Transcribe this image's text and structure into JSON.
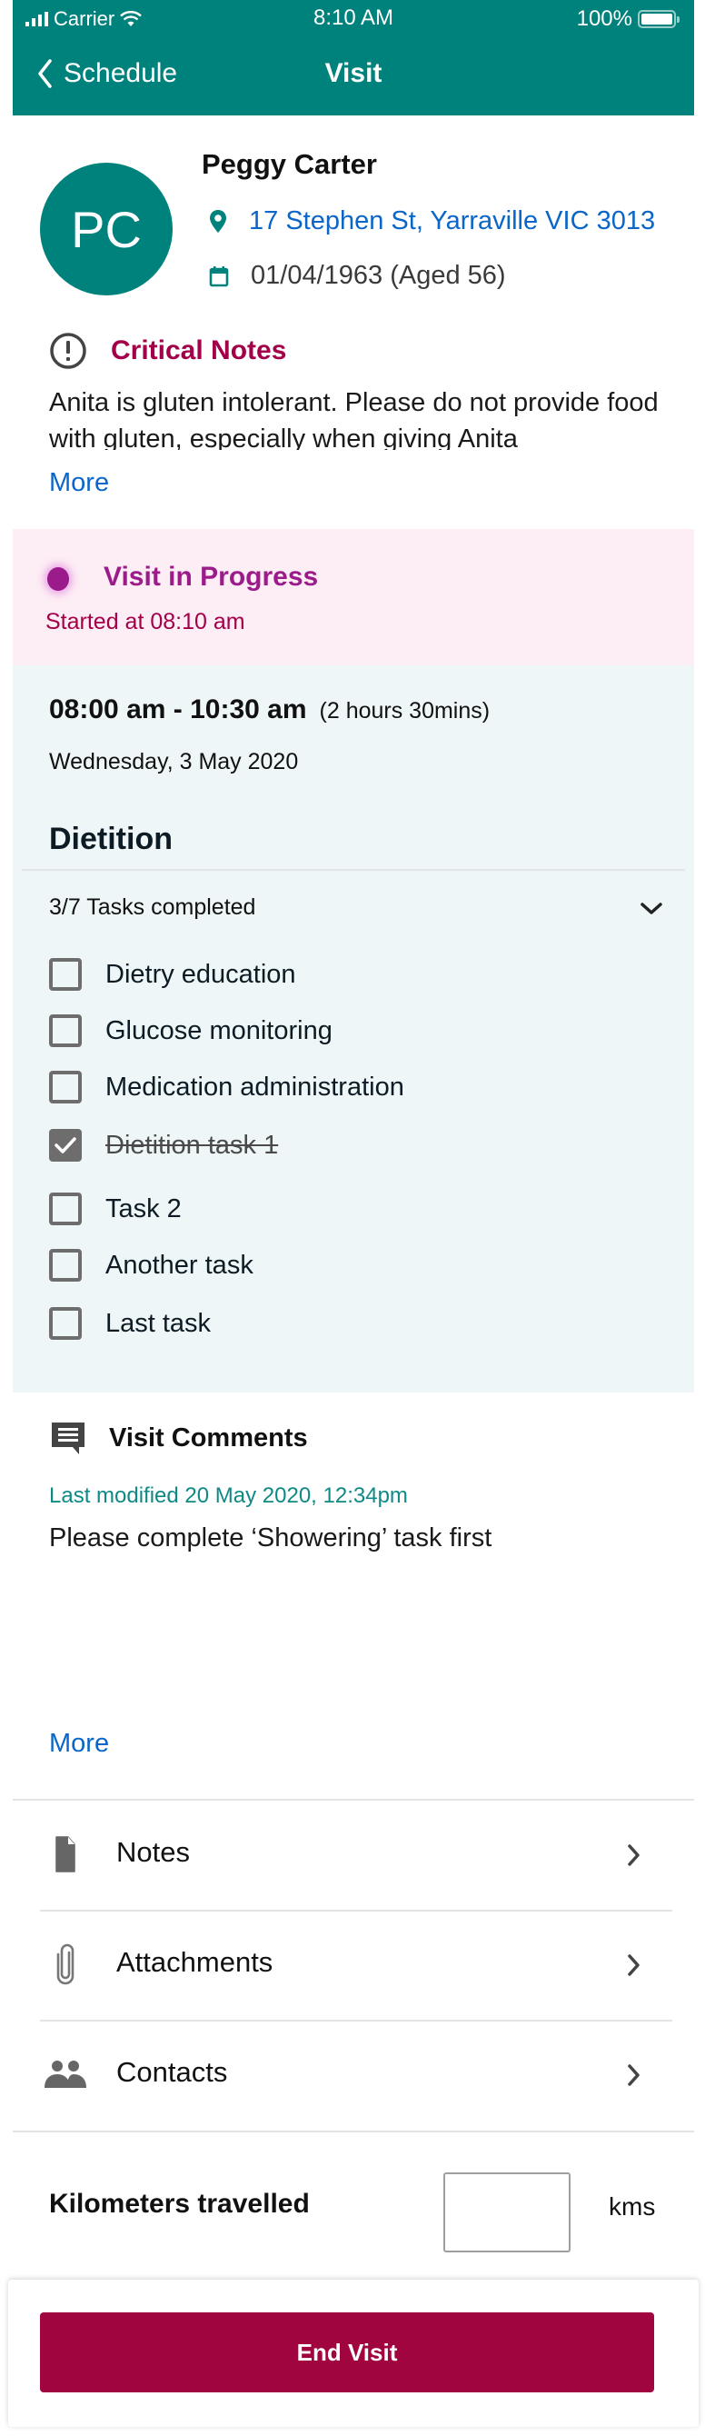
{
  "status_bar": {
    "carrier": "Carrier",
    "time": "8:10 AM",
    "battery": "100%"
  },
  "nav": {
    "back_label": "Schedule",
    "title": "Visit"
  },
  "colors": {
    "brand_teal": "#00827C",
    "critical": "#A3004A",
    "progress": "#9B1B8B",
    "link": "#0A66C8",
    "end_button": "#A00540"
  },
  "client": {
    "initials": "PC",
    "name": "Peggy Carter",
    "address": "17 Stephen St, Yarraville VIC 3013",
    "dob": "01/04/1963 (Aged 56)",
    "address_icon": "location-pin-icon",
    "dob_icon": "calendar-icon"
  },
  "critical_notes": {
    "icon": "alert-circle-icon",
    "title": "Critical Notes",
    "body": "Anita is gluten intolerant. Please do not provide food with gluten, especially when giving Anita",
    "more_label": "More"
  },
  "visit_status": {
    "title": "Visit in Progress",
    "started": "Started at 08:10 am"
  },
  "visit": {
    "time_range": "08:00 am - 10:30 am",
    "duration": "(2 hours 30mins)",
    "date": "Wednesday, 3 May 2020",
    "service": "Dietition",
    "tasks_summary": "3/7 Tasks completed",
    "tasks": [
      {
        "label": "Dietry education",
        "checked": false
      },
      {
        "label": "Glucose monitoring",
        "checked": false
      },
      {
        "label": "Medication administration",
        "checked": false
      },
      {
        "label": "Dietition task 1",
        "checked": true
      },
      {
        "label": "Task 2",
        "checked": false
      },
      {
        "label": "Another task",
        "checked": false
      },
      {
        "label": "Last task",
        "checked": false
      }
    ]
  },
  "comments": {
    "icon": "comment-icon",
    "title": "Visit Comments",
    "last_modified": "Last modified 20 May 2020, 12:34pm",
    "body": "Please complete ‘Showering’ task first",
    "more_label": "More"
  },
  "links": [
    {
      "label": "Notes",
      "icon": "document-icon"
    },
    {
      "label": "Attachments",
      "icon": "paperclip-icon"
    },
    {
      "label": "Contacts",
      "icon": "people-icon"
    }
  ],
  "kilometers": {
    "label": "Kilometers travelled",
    "value": "",
    "unit": "kms"
  },
  "footer": {
    "end_visit_label": "End Visit"
  }
}
